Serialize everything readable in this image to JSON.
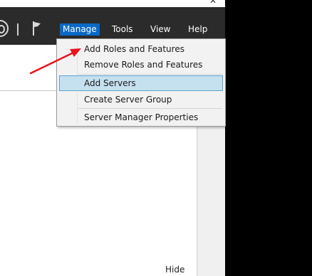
{
  "title_bar": {
    "close_glyph": "✕"
  },
  "menubar": {
    "icons": [
      "refresh-icon",
      "flag-icon"
    ],
    "items": [
      {
        "label": "Manage",
        "active": true
      },
      {
        "label": "Tools",
        "active": false
      },
      {
        "label": "View",
        "active": false
      },
      {
        "label": "Help",
        "active": false
      }
    ]
  },
  "manage_menu": {
    "items": [
      {
        "label": "Add Roles and Features"
      },
      {
        "label": "Remove Roles and Features"
      },
      {
        "label": "Add Servers",
        "highlighted": true
      },
      {
        "label": "Create Server Group"
      },
      {
        "label": "Server Manager Properties"
      }
    ]
  },
  "panel": {
    "hide_label": "Hide"
  },
  "annotation": {
    "type": "red-arrow",
    "points_to": "Add Roles and Features",
    "color": "#e8141c"
  },
  "colors": {
    "menubar_bg": "#2b2b2b",
    "active_menu_bg": "#0a68c6",
    "menu_bg": "#f2f2f2",
    "hover_bg": "#c5e0ef",
    "hover_border": "#5ea3cf"
  }
}
